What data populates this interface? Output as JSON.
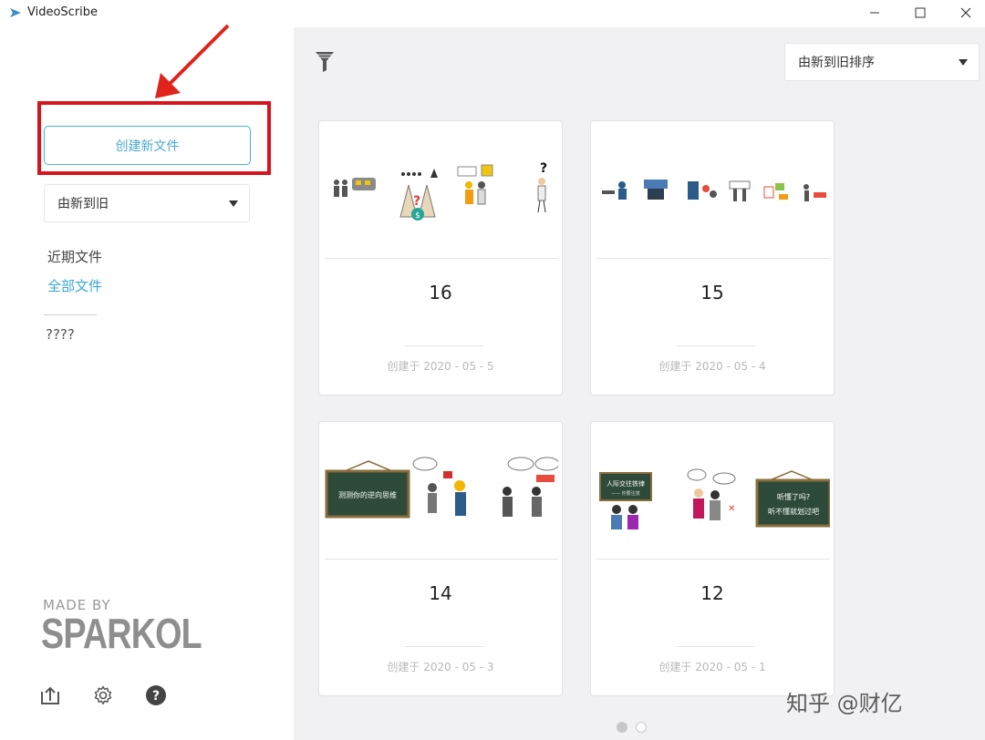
{
  "window": {
    "title": "VideoScribe",
    "icons": {
      "app": "videoscribe-icon",
      "minimize": "minimize-icon",
      "maximize": "maximize-icon",
      "close": "close-icon"
    }
  },
  "sidebar": {
    "new_file_button": "创建新文件",
    "sort_select": {
      "value": "由新到旧"
    },
    "nav": {
      "recent": "近期文件",
      "all": "全部文件",
      "other": "????"
    },
    "brand": {
      "made_by": "MADE BY",
      "name": "SPARKOL"
    },
    "bottom_icons": [
      "upload-icon",
      "settings-icon",
      "help-icon"
    ]
  },
  "main": {
    "filter_icon": "filter-icon",
    "sort_select": {
      "value": "由新到旧排序"
    },
    "projects": [
      {
        "title": "16",
        "created": "创建于 2020 - 05 - 5"
      },
      {
        "title": "15",
        "created": "创建于 2020 - 05 - 4"
      },
      {
        "title": "14",
        "created": "创建于 2020 - 05 - 3"
      },
      {
        "title": "12",
        "created": "创建于 2020 - 05 - 1"
      }
    ],
    "thumb_text": {
      "p14_board": "测测你的逆向思维",
      "p12_board_left": "人际交往铁律",
      "p12_board_left_sub": "—— 你要注意",
      "p12_board_right_1": "听懂了吗?",
      "p12_board_right_2": "听不懂就划过吧"
    },
    "pagination": {
      "pages": 2,
      "current": 1
    }
  },
  "watermark": "知乎 @财亿",
  "colors": {
    "accent": "#4aa9cf",
    "highlight": "#d7141c",
    "arrow": "#e0231d",
    "main_bg": "#f1f1f3"
  }
}
